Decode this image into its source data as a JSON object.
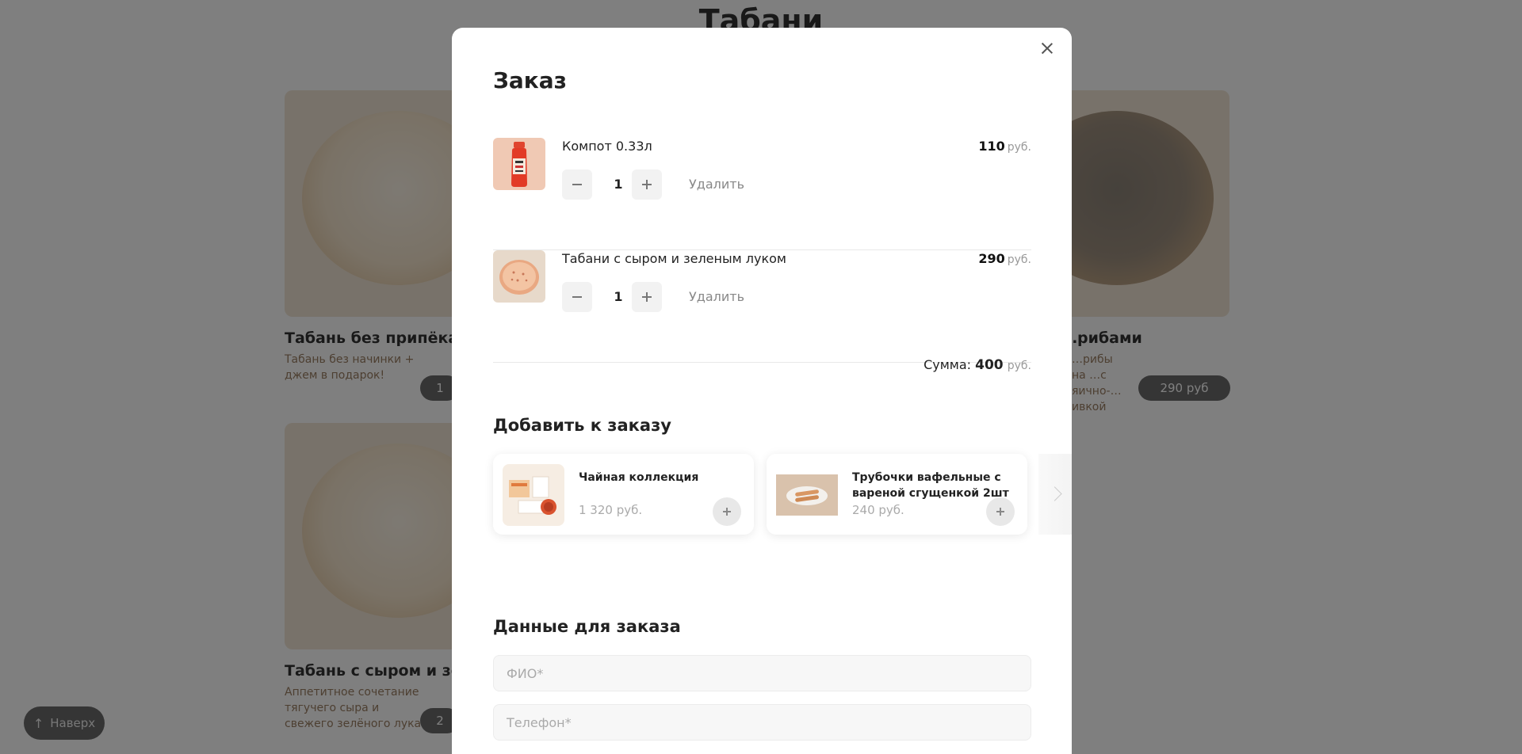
{
  "background": {
    "section_title": "Табани",
    "cards": [
      {
        "title": "Табань без припёка",
        "desc": "Табань без начинки + джем в подарок!",
        "price": "1"
      },
      {
        "title": "…рибами",
        "desc": "…рибы на …с яично-…ивкой",
        "price": "290 руб"
      },
      {
        "title": "Табань с сыром и зелён",
        "desc": "Аппетитное сочетание тягучего сыра и свежего зелёного лука",
        "price": "2"
      }
    ],
    "scroll_top_label": "Наверх"
  },
  "modal": {
    "title": "Заказ",
    "items": [
      {
        "name": "Компот 0.33л",
        "price": "110",
        "currency": "руб.",
        "qty": "1",
        "remove_label": "Удалить"
      },
      {
        "name": "Табани с сыром и зеленым луком",
        "price": "290",
        "currency": "руб.",
        "qty": "1",
        "remove_label": "Удалить"
      }
    ],
    "sum": {
      "label": "Сумма:",
      "value": "400",
      "currency": "руб."
    },
    "addons_title": "Добавить к заказу",
    "addons": [
      {
        "name": "Чайная коллекция",
        "price": "1 320 руб."
      },
      {
        "name": "Трубочки вафельные с вареной сгущенкой 2шт",
        "price": "240 руб."
      }
    ],
    "form_title": "Данные для заказа",
    "fields": {
      "name_placeholder": "ФИО*",
      "phone_placeholder": "Телефон*"
    }
  }
}
